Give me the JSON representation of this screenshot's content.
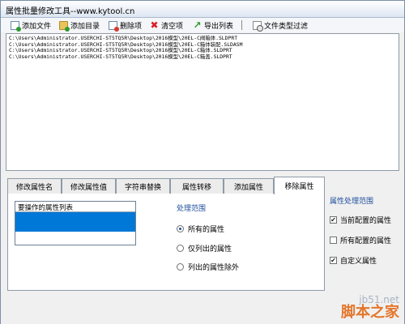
{
  "window": {
    "title": "属性批量修改工具--www.kytool.cn"
  },
  "toolbar": {
    "add_file": {
      "label": "添加文件",
      "icon": "add-file-icon"
    },
    "add_folder": {
      "label": "添加目录",
      "icon": "add-folder-icon"
    },
    "delete": {
      "label": "删除项",
      "icon": "delete-icon"
    },
    "clear": {
      "label": "清空项",
      "icon": "clear-icon",
      "color": "#d8202a"
    },
    "export": {
      "label": "导出列表",
      "icon": "export-icon",
      "color": "#2f9a2f"
    },
    "filter": {
      "label": "文件类型过滤",
      "icon": "filter-icon"
    }
  },
  "file_list": {
    "rows": [
      "C:\\Users\\Administrator.USERCHI-ST5TQ5R\\Desktop\\2016模型\\20EL-C阀箱体.SLDPRT",
      "C:\\Users\\Administrator.USERCHI-ST5TQ5R\\Desktop\\2016模型\\20EL-C箱体装配.SLDASM",
      "C:\\Users\\Administrator.USERCHI-ST5TQ5R\\Desktop\\2016模型\\20EL-C箱体.SLDPRT",
      "C:\\Users\\Administrator.USERCHI-ST5TQ5R\\Desktop\\2016模型\\20EL-C箱盖.SLDPRT"
    ]
  },
  "tabs": [
    {
      "label": "修改属性名"
    },
    {
      "label": "修改属性值"
    },
    {
      "label": "字符串替换"
    },
    {
      "label": "属性转移"
    },
    {
      "label": "添加属性"
    },
    {
      "label": "移除属性"
    }
  ],
  "active_tab": "移除属性",
  "remove_panel": {
    "list_header": "要操作的属性列表",
    "range_label": "处理范围",
    "options": [
      {
        "label": "所有的属性",
        "selected": true
      },
      {
        "label": "仅列出的属性",
        "selected": false
      },
      {
        "label": "列出的属性除外",
        "selected": false
      }
    ]
  },
  "property_range": {
    "title": "属性处理范围",
    "checks": [
      {
        "label": "当前配置的属性",
        "checked": true
      },
      {
        "label": "所有配置的属性",
        "checked": false
      },
      {
        "label": "自定义属性",
        "checked": true
      }
    ]
  },
  "watermark": {
    "site": "jb51.net",
    "name": "脚本之家"
  },
  "colors": {
    "selection": "#0078d7",
    "group_title": "#1f4e9c",
    "watermark": "#e3762b"
  }
}
